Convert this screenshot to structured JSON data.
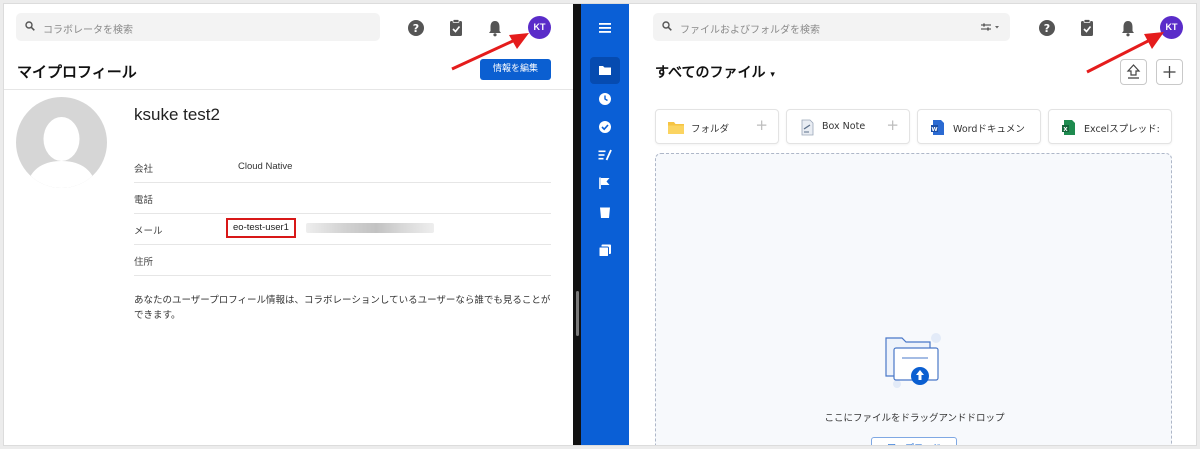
{
  "left": {
    "search": {
      "placeholder": "コラボレータを検索"
    },
    "avatar": {
      "initials": "KT",
      "color": "#5a2cc9"
    },
    "page_title": "マイプロフィール",
    "edit_button": "情報を編集",
    "user_name": "ksuke test2",
    "fields": [
      {
        "label": "会社",
        "value": "Cloud Native"
      },
      {
        "label": "電話",
        "value": ""
      },
      {
        "label": "メール",
        "value": "eo-test-user1"
      },
      {
        "label": "住所",
        "value": ""
      }
    ],
    "description": "あなたのユーザープロフィール情報は、コラボレーションしているユーザーなら誰でも見ることができます。"
  },
  "sidebar": {
    "accent": "#0a5fd6",
    "items": [
      "menu-icon",
      "folder-icon",
      "clock-icon",
      "check-circle-icon",
      "tasks-icon",
      "flag-icon",
      "trash-icon",
      "copy-icon"
    ]
  },
  "right": {
    "search": {
      "placeholder": "ファイルおよびフォルダを検索"
    },
    "avatar": {
      "initials": "KT",
      "color": "#5a2cc9"
    },
    "title": "すべてのファイル",
    "cards": [
      {
        "label": "フォルダ",
        "icon": "folder-icon"
      },
      {
        "label": "Box Note",
        "icon": "box-note-icon"
      },
      {
        "label": "Wordドキュメン",
        "icon": "word-icon"
      },
      {
        "label": "Excelスプレッド:",
        "icon": "excel-icon"
      }
    ],
    "drop_text": "ここにファイルをドラッグアンドドロップ",
    "upload_button": "アップロード"
  },
  "colors": {
    "primary": "#0b5fd1",
    "highlight": "#d81818",
    "arrow": "#e51c1c"
  }
}
